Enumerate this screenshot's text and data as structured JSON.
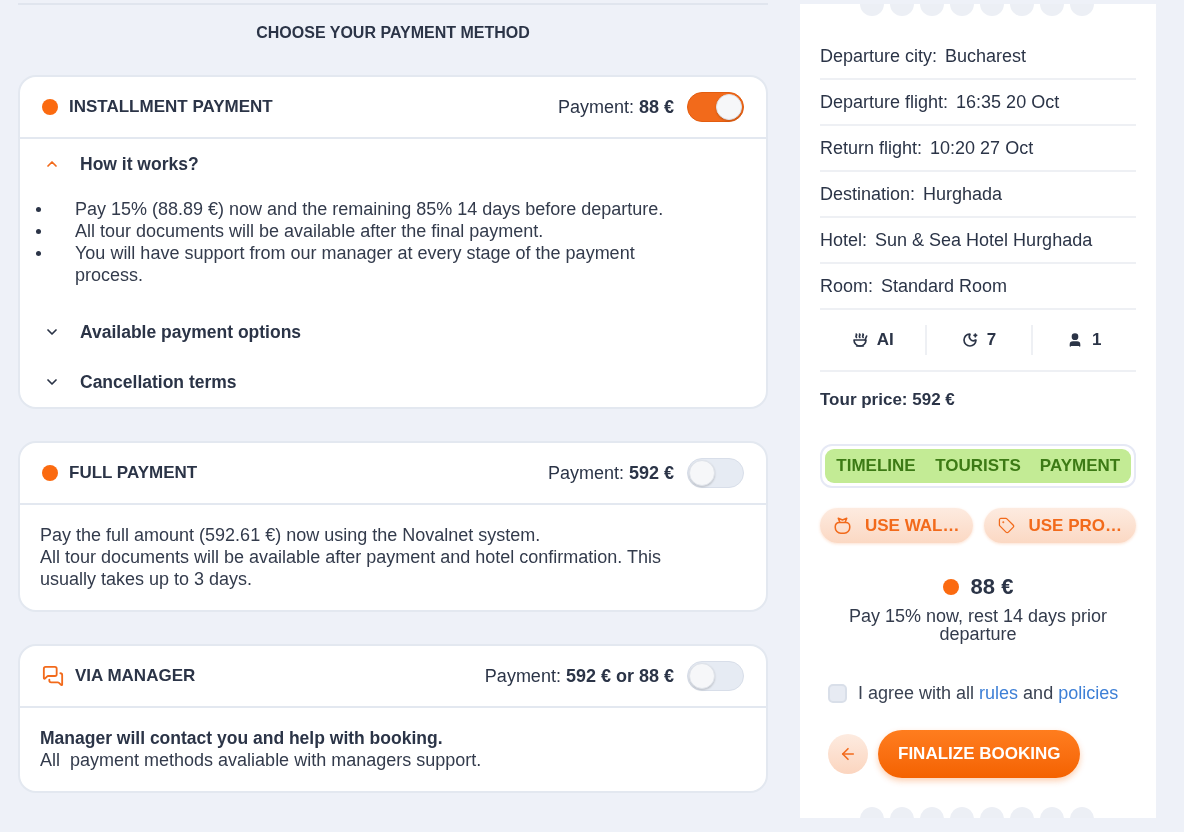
{
  "heading": "CHOOSE YOUR PAYMENT METHOD",
  "payment_methods": [
    {
      "kind": "dot",
      "title": "INSTALLMENT PAYMENT",
      "payment": "Payment: **88 €**",
      "on": true,
      "sections": [
        {
          "title": "How it works?",
          "expanded": true,
          "bullets": [
            "Pay 15% (88.89 €) now and the remaining 85% 14 days before departure.",
            "All tour documents will be available after the final payment.",
            "You will have support from our manager at every stage of the payment process."
          ]
        },
        {
          "title": "Available payment options",
          "expanded": false
        },
        {
          "title": "Cancellation terms",
          "expanded": false
        }
      ]
    },
    {
      "kind": "dot",
      "title": "FULL PAYMENT",
      "payment": "Payment: **592 €**",
      "on": false,
      "lines": [
        {
          "text": "Pay the full amount (592.61 €) now using the Novalnet system.",
          "bold": false
        },
        {
          "text": "All tour documents will be available after payment and hotel confirmation. This usually takes up to 3 days.",
          "bold": false
        }
      ]
    },
    {
      "kind": "chat",
      "title": "VIA MANAGER",
      "payment": "Payment: **592 € or 88 €**",
      "on": false,
      "lines": [
        {
          "text": "Manager will contact you and help with booking.",
          "bold": true
        },
        {
          "text": "All  payment methods avaliable with managers support.",
          "bold": false
        }
      ]
    }
  ],
  "tour": {
    "details": [
      {
        "label": "Departure city:",
        "value": "Bucharest"
      },
      {
        "label": "Departure flight:",
        "value": "16:35 20 Oct"
      },
      {
        "label": "Return flight:",
        "value": "10:20 27 Oct"
      },
      {
        "label": "Destination:",
        "value": "Hurghada"
      },
      {
        "label": "Hotel:",
        "value": "Sun & Sea Hotel Hurghada"
      },
      {
        "label": "Room:",
        "value": "Standard Room"
      }
    ],
    "stats": [
      {
        "kind": "meal",
        "value": "AI"
      },
      {
        "kind": "nights",
        "value": "7"
      },
      {
        "kind": "tourists",
        "value": "1"
      }
    ],
    "price": "Tour price: 592 €"
  },
  "steps": [
    {
      "label": "TIMELINE",
      "done": true
    },
    {
      "label": "TOURISTS",
      "done": true
    },
    {
      "label": "PAYMENT",
      "done": true
    }
  ],
  "actions": [
    {
      "kind": "wallet",
      "label": "USE WAL…"
    },
    {
      "kind": "promo",
      "label": "USE PRO…"
    }
  ],
  "summary": {
    "amount": "88 €",
    "note": "Pay 15% now, rest 14 days prior departure"
  },
  "agreement": {
    "checked": false,
    "segments": [
      {
        "kind": "text",
        "text": "I agree with all"
      },
      {
        "kind": "link",
        "text": "rules"
      },
      {
        "kind": "text",
        "text": "and"
      },
      {
        "kind": "link",
        "text": "policies"
      }
    ]
  },
  "finalize_button": "FINALIZE BOOKING"
}
